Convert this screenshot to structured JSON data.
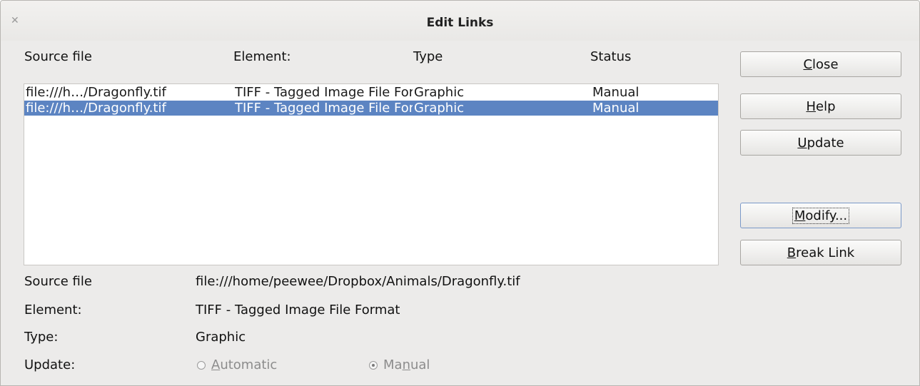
{
  "window": {
    "title": "Edit Links"
  },
  "list": {
    "headers": {
      "source": "Source file",
      "element": "Element:",
      "type": "Type",
      "status": "Status"
    },
    "rows": [
      {
        "source": "file:///h…/Dragonfly.tif",
        "element": "TIFF - Tagged Image File Format",
        "type": "Graphic",
        "status": "Manual",
        "selected": false
      },
      {
        "source": "file:///h…/Dragonfly.tif",
        "element": "TIFF - Tagged Image File Format",
        "type": "Graphic",
        "status": "Manual",
        "selected": true
      }
    ]
  },
  "buttons": {
    "close": {
      "mnemonic": "C",
      "rest": "lose"
    },
    "help": {
      "mnemonic": "H",
      "rest": "elp"
    },
    "update": {
      "mnemonic": "U",
      "rest": "pdate"
    },
    "modify": {
      "mnemonic": "M",
      "rest": "odify..."
    },
    "break_link": {
      "mnemonic": "B",
      "rest": "reak Link"
    }
  },
  "details": {
    "source_label": "Source file",
    "source_value": "file:///home/peewee/Dropbox/Animals/Dragonfly.tif",
    "element_label": "Element:",
    "element_value": "TIFF - Tagged Image File Format",
    "type_label": "Type:",
    "type_value": "Graphic",
    "update_label": "Update:",
    "automatic": {
      "mnemonic": "A",
      "rest": "utomatic",
      "checked": false
    },
    "manual": {
      "pre": "Ma",
      "mnemonic": "n",
      "rest": "ual",
      "checked": true
    }
  },
  "colors": {
    "selection": "#5c84c2",
    "dialog_bg": "#ecebea"
  }
}
